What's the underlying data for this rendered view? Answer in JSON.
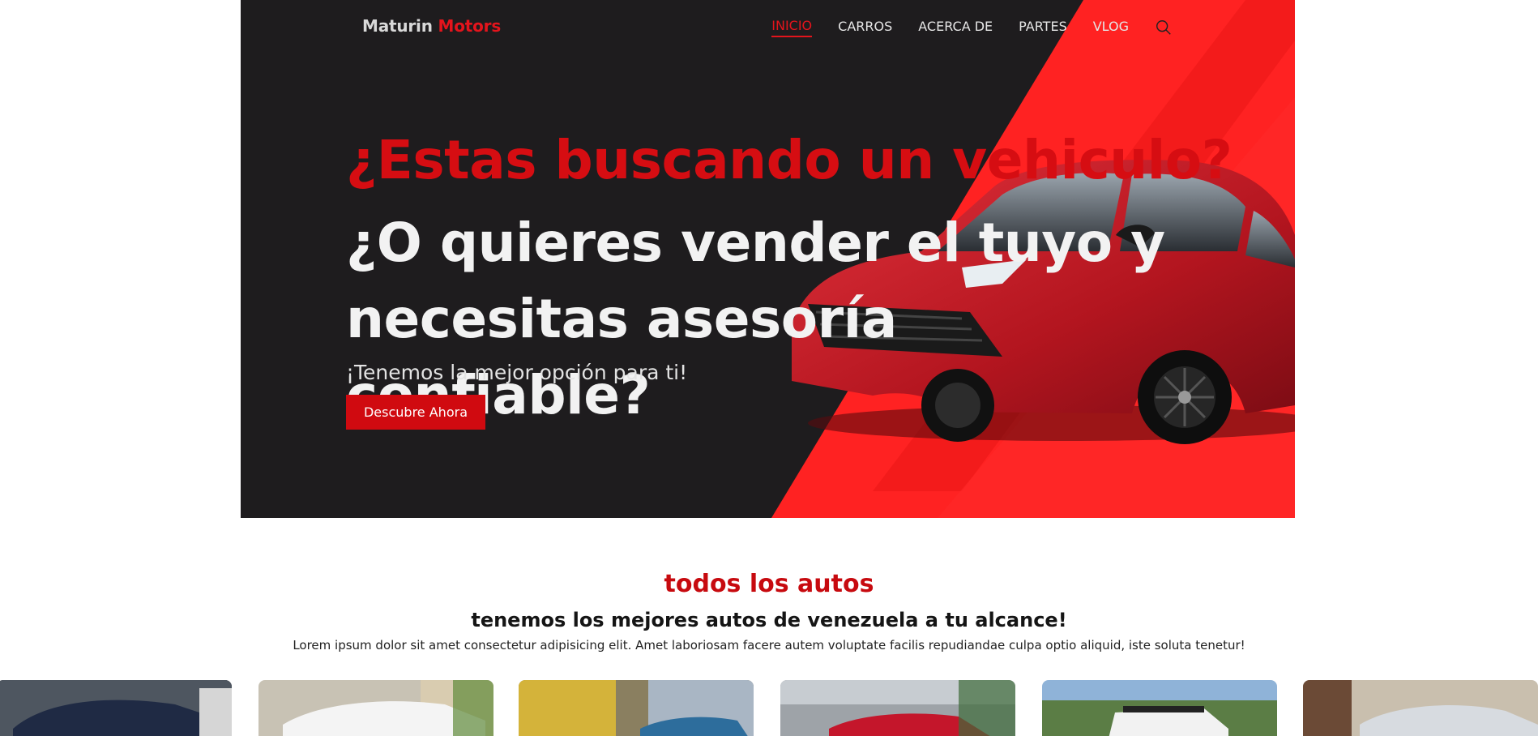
{
  "brand": {
    "part1": "Maturin",
    "part2": "Motors"
  },
  "nav": {
    "items": [
      {
        "label": "INICIO",
        "active": true
      },
      {
        "label": "CARROS",
        "active": false
      },
      {
        "label": "ACERCA DE",
        "active": false
      },
      {
        "label": "PARTES",
        "active": false
      },
      {
        "label": "VLOG",
        "active": false
      }
    ],
    "search_icon": "search-icon"
  },
  "hero": {
    "headline": "¿Estas buscando un vehiculo?",
    "headline2_line1": "¿O quieres vender el tuyo y",
    "headline2_line2": "necesitas asesoría confiable?",
    "subtitle": "¡Tenemos la mejor opción para ti!",
    "cta_label": "Descubre Ahora"
  },
  "section": {
    "title": "todos los autos",
    "subtitle": "tenemos los mejores autos de venezuela a tu alcance!",
    "description": "Lorem ipsum dolor sit amet consectetur adipisicing elit. Amet laboriosam facere autem voluptate facilis repudiandae culpa optio aliquid, iste soluta tenetur!"
  },
  "colors": {
    "accent": "#d60d12",
    "hero_bg": "#1e1c1e",
    "stripe_red": "#ff2020"
  }
}
